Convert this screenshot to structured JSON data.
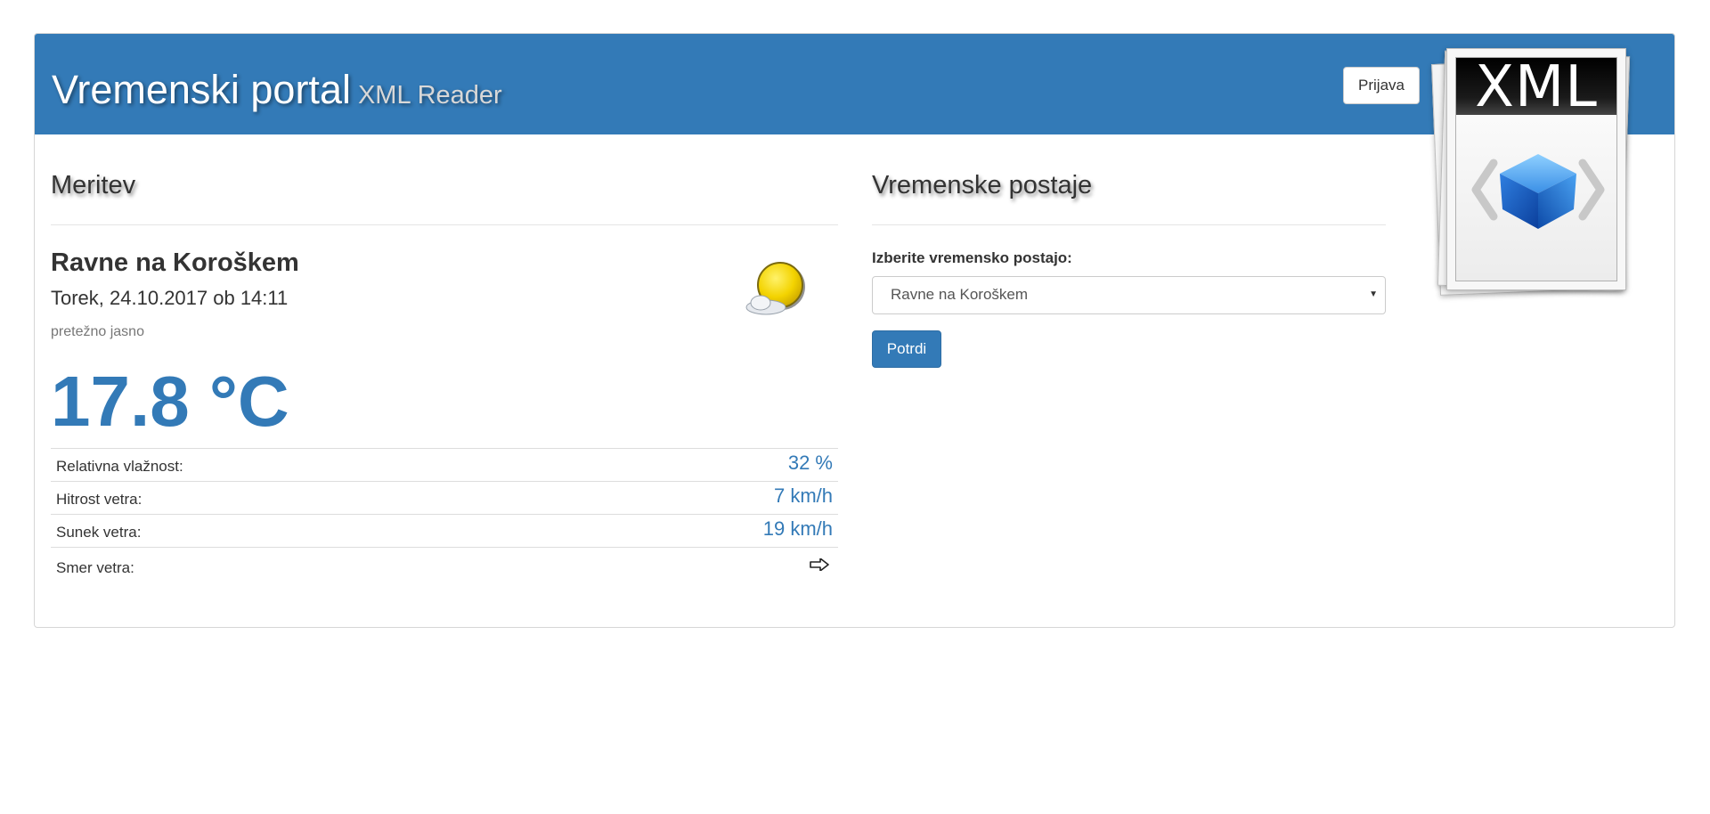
{
  "header": {
    "title": "Vremenski portal",
    "subtitle": "XML Reader",
    "login_label": "Prijava",
    "logo_text": "XML",
    "accent_color": "#337ab7"
  },
  "measurement": {
    "section_title": "Meritev",
    "location": "Ravne na Koroškem",
    "datetime": "Torek, 24.10.2017 ob 14:11",
    "condition": "pretežno jasno",
    "condition_icon": "partly-cloudy-sun-icon",
    "temperature": "17.8 °C",
    "rows": [
      {
        "label": "Relativna vlažnost:",
        "value": "32 %"
      },
      {
        "label": "Hitrost vetra:",
        "value": "7 km/h"
      },
      {
        "label": "Sunek vetra:",
        "value": "19 km/h"
      }
    ],
    "wind_direction": {
      "label": "Smer vetra:",
      "icon": "arrow-right-icon"
    }
  },
  "stations": {
    "section_title": "Vremenske postaje",
    "select_label": "Izberite vremensko postajo:",
    "selected_station": "Ravne na Koroškem",
    "submit_label": "Potrdi"
  }
}
